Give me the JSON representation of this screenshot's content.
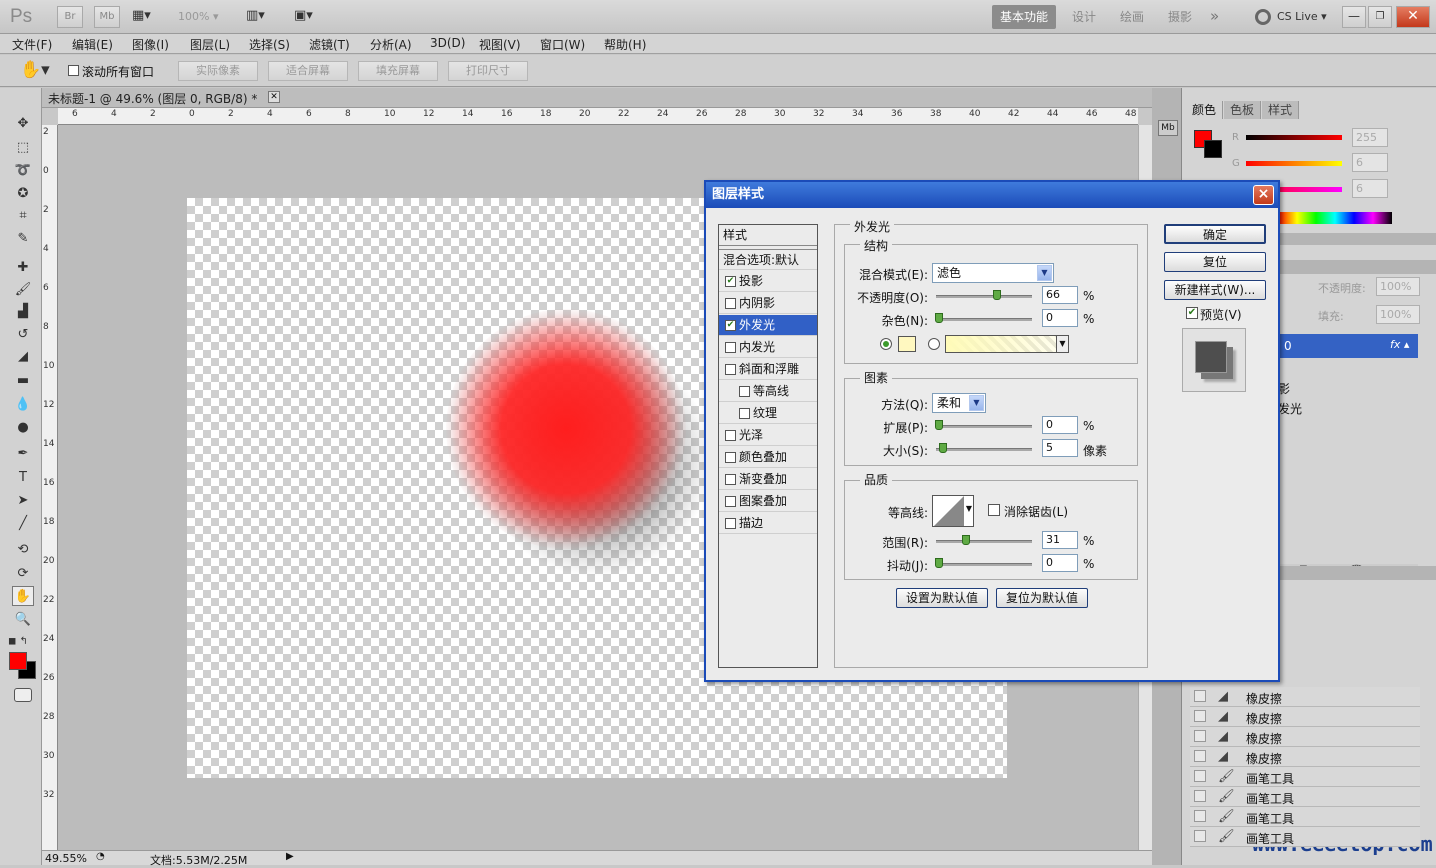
{
  "app": {
    "logo": "Ps",
    "zoom_select": "100%",
    "workspaces": [
      "基本功能",
      "设计",
      "绘画",
      "摄影"
    ],
    "cs_live": "CS Live"
  },
  "menu": [
    "文件(F)",
    "编辑(E)",
    "图像(I)",
    "图层(L)",
    "选择(S)",
    "滤镜(T)",
    "分析(A)",
    "3D(D)",
    "视图(V)",
    "窗口(W)",
    "帮助(H)"
  ],
  "options": {
    "scroll_all": "滚动所有窗口",
    "buttons": [
      "实际像素",
      "适合屏幕",
      "填充屏幕",
      "打印尺寸"
    ]
  },
  "document": {
    "tab_title": "未标题-1 @ 49.6% (图层 0, RGB/8) *",
    "ruler_h": [
      "6",
      "4",
      "2",
      "0",
      "2",
      "4",
      "6",
      "8",
      "10",
      "12",
      "14",
      "16",
      "18",
      "20",
      "22",
      "24",
      "26",
      "28",
      "30",
      "32",
      "34",
      "36",
      "38",
      "40",
      "42",
      "44",
      "46",
      "48"
    ],
    "ruler_v": [
      "2",
      "0",
      "2",
      "4",
      "6",
      "8",
      "10",
      "12",
      "14",
      "16",
      "18",
      "20",
      "22",
      "24",
      "26",
      "28",
      "30",
      "32"
    ]
  },
  "status": {
    "zoom": "49.55%",
    "doc": "文档:5.53M/2.25M"
  },
  "panels": {
    "color_tabs": [
      "颜色",
      "色板",
      "样式"
    ],
    "channels": [
      {
        "label": "R",
        "value": "255"
      },
      {
        "label": "G",
        "value": "6"
      },
      {
        "label": "B",
        "value": "6"
      }
    ],
    "fg_color": "#ff0000",
    "bg_color": "#000000",
    "layers_opacity_label": "不透明度:",
    "layers_opacity_value": "100%",
    "layers_fill_label": "填充:",
    "layers_fill_value": "100%",
    "layer_name": "0",
    "layer_effects": [
      "影",
      "发光"
    ],
    "history": [
      {
        "icon": "eraser-icon",
        "label": "橡皮擦"
      },
      {
        "icon": "eraser-icon",
        "label": "橡皮擦"
      },
      {
        "icon": "eraser-icon",
        "label": "橡皮擦"
      },
      {
        "icon": "eraser-icon",
        "label": "橡皮擦"
      },
      {
        "icon": "brush-icon",
        "label": "画笔工具"
      },
      {
        "icon": "brush-icon",
        "label": "画笔工具"
      },
      {
        "icon": "brush-icon",
        "label": "画笔工具"
      },
      {
        "icon": "brush-icon",
        "label": "画笔工具"
      }
    ],
    "watermark": "www.eeeetop.com"
  },
  "dialog": {
    "title": "图层样式",
    "close": "×",
    "styles_header": "样式",
    "blend_default": "混合选项:默认",
    "styles": [
      {
        "label": "投影",
        "checked": true,
        "indent": false,
        "selected": false
      },
      {
        "label": "内阴影",
        "checked": false,
        "indent": false,
        "selected": false
      },
      {
        "label": "外发光",
        "checked": true,
        "indent": false,
        "selected": true
      },
      {
        "label": "内发光",
        "checked": false,
        "indent": false,
        "selected": false
      },
      {
        "label": "斜面和浮雕",
        "checked": false,
        "indent": false,
        "selected": false
      },
      {
        "label": "等高线",
        "checked": false,
        "indent": true,
        "selected": false
      },
      {
        "label": "纹理",
        "checked": false,
        "indent": true,
        "selected": false
      },
      {
        "label": "光泽",
        "checked": false,
        "indent": false,
        "selected": false
      },
      {
        "label": "颜色叠加",
        "checked": false,
        "indent": false,
        "selected": false
      },
      {
        "label": "渐变叠加",
        "checked": false,
        "indent": false,
        "selected": false
      },
      {
        "label": "图案叠加",
        "checked": false,
        "indent": false,
        "selected": false
      },
      {
        "label": "描边",
        "checked": false,
        "indent": false,
        "selected": false
      }
    ],
    "section_title": "外发光",
    "structure": {
      "title": "结构",
      "blend_mode_label": "混合模式(E):",
      "blend_mode_value": "滤色",
      "opacity_label": "不透明度(O):",
      "opacity_value": "66",
      "opacity_level": 0.66,
      "noise_label": "杂色(N):",
      "noise_value": "0",
      "noise_level": 0.0,
      "glow_color": "#fff8c0",
      "percent": "%"
    },
    "elements": {
      "title": "图素",
      "technique_label": "方法(Q):",
      "technique_value": "柔和",
      "spread_label": "扩展(P):",
      "spread_value": "0",
      "spread_level": 0.0,
      "size_label": "大小(S):",
      "size_value": "5",
      "size_level": 0.04,
      "size_unit": "像素"
    },
    "quality": {
      "title": "品质",
      "contour_label": "等高线:",
      "antialias_label": "消除锯齿(L)",
      "range_label": "范围(R):",
      "range_value": "31",
      "range_level": 0.31,
      "jitter_label": "抖动(J):",
      "jitter_value": "0",
      "jitter_level": 0.0
    },
    "make_default": "设置为默认值",
    "reset_default": "复位为默认值",
    "buttons": {
      "ok": "确定",
      "cancel": "复位",
      "new_style": "新建样式(W)...",
      "preview": "预览(V)"
    }
  }
}
